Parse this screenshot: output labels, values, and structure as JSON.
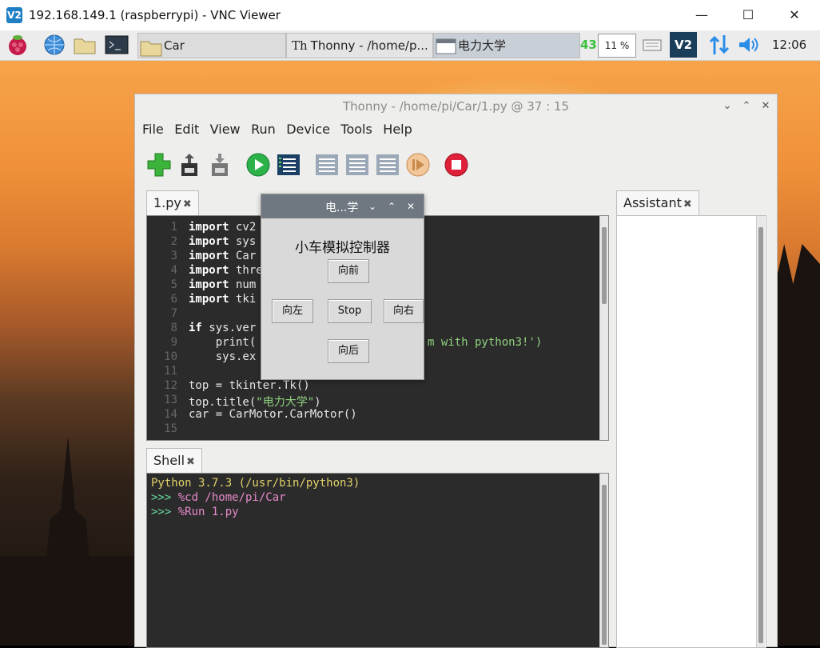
{
  "vnc": {
    "title": "192.168.149.1 (raspberrypi) - VNC Viewer",
    "icon_label": "V2",
    "controls": {
      "minimize": "—",
      "maximize": "☐",
      "close": "✕"
    }
  },
  "taskbar": {
    "car_folder_label": "Car",
    "thonny_task_label": "Thonny  -  /home/p...",
    "tk_task_label": "电力大学",
    "cpu_temp": "43",
    "cpu_usage": "11 %",
    "vnc_tray_label": "V2",
    "clock": "12:06"
  },
  "thonny": {
    "title": "Thonny  -  /home/pi/Car/1.py  @  37 : 15",
    "menu": [
      "File",
      "Edit",
      "View",
      "Run",
      "Device",
      "Tools",
      "Help"
    ],
    "editor_tab": "1.py",
    "shell_tab": "Shell",
    "assistant_tab": "Assistant",
    "tab_close": "✖",
    "code_lines": [
      {
        "n": "1",
        "kw": "import",
        "rest": " cv2"
      },
      {
        "n": "2",
        "kw": "import",
        "rest": " sys"
      },
      {
        "n": "3",
        "kw": "import",
        "rest": " Car"
      },
      {
        "n": "4",
        "kw": "import",
        "rest": " thre"
      },
      {
        "n": "5",
        "kw": "import",
        "rest": " num"
      },
      {
        "n": "6",
        "kw": "import",
        "rest": " tki"
      },
      {
        "n": "7",
        "kw": "",
        "rest": ""
      },
      {
        "n": "8",
        "kw": "if",
        "rest": " sys.ver"
      },
      {
        "n": "9",
        "kw": "",
        "rest": "    print("
      },
      {
        "n": "10",
        "kw": "",
        "rest": "    sys.ex"
      },
      {
        "n": "11",
        "kw": "",
        "rest": ""
      },
      {
        "n": "12",
        "kw": "",
        "rest": "top = tkinter.Tk()"
      },
      {
        "n": "13",
        "kw": "",
        "rest": "top.title("
      },
      {
        "n": "14",
        "kw": "",
        "rest": "car = CarMotor.CarMotor()"
      },
      {
        "n": "15",
        "kw": "",
        "rest": ""
      }
    ],
    "line9_tail": "m with python3!')",
    "line13_string": "\"电力大学\"",
    "line13_end": ")",
    "shell_lines": [
      {
        "text": "Python 3.7.3 (/usr/bin/python3)",
        "color": "#e2d16a"
      },
      {
        "text": ">>> %cd /home/pi/Car",
        "color": "#e98acb"
      },
      {
        "text": ">>> %Run 1.py",
        "color": "#e98acb"
      }
    ]
  },
  "tk_dialog": {
    "title": "电...学",
    "heading": "小车模拟控制器",
    "buttons": {
      "forward": "向前",
      "left": "向左",
      "stop": "Stop",
      "right": "向右",
      "backward": "向后"
    }
  },
  "colors": {
    "prompt": "#66d9a0",
    "shell_cmd": "#e98acb"
  }
}
